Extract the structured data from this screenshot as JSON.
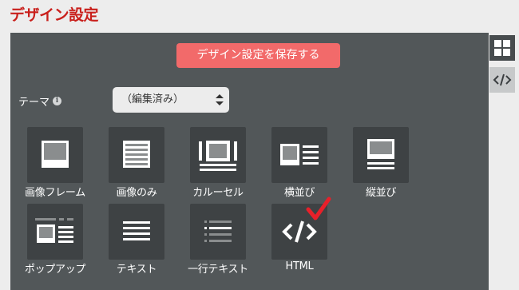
{
  "header": {
    "title": "デザイン設定"
  },
  "toolbar": {
    "save_label": "デザイン設定を保存する"
  },
  "theme": {
    "label": "テーマ",
    "info_icon": "info-icon",
    "selected_value": "（編集済み）"
  },
  "templates": [
    {
      "label": "画像フレーム",
      "icon": "image-frame-icon"
    },
    {
      "label": "画像のみ",
      "icon": "image-only-icon"
    },
    {
      "label": "カルーセル",
      "icon": "carousel-icon"
    },
    {
      "label": "横並び",
      "icon": "horizontal-layout-icon"
    },
    {
      "label": "縦並び",
      "icon": "vertical-layout-icon"
    },
    {
      "label": "ポップアップ",
      "icon": "popup-icon"
    },
    {
      "label": "テキスト",
      "icon": "text-icon"
    },
    {
      "label": "一行テキスト",
      "icon": "one-line-text-icon"
    },
    {
      "label": "HTML",
      "icon": "html-code-icon",
      "selected": true
    }
  ],
  "side_toolbar": [
    {
      "name": "layout-view",
      "icon": "grid-icon"
    },
    {
      "name": "code-view",
      "icon": "code-icon"
    }
  ],
  "colors": {
    "title": "#c9201c",
    "panel": "#525759",
    "tile": "#3e4244",
    "save_button": "#f26a6a",
    "check": "#e8202a"
  }
}
